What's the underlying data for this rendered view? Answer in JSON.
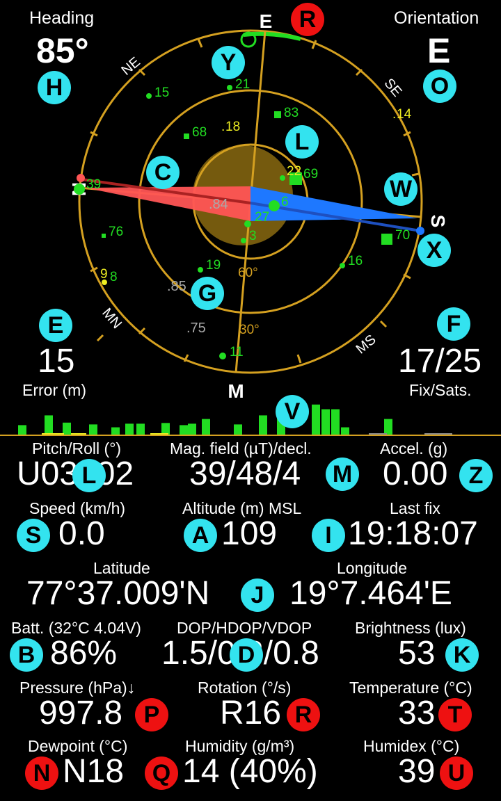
{
  "header": {
    "heading_label": "Heading",
    "heading_value": "85°",
    "orientation_label": "Orientation",
    "orientation_value": "E"
  },
  "compass": {
    "directions": {
      "n": "N",
      "ne": "NE",
      "e": "E",
      "se": "SE",
      "s": "S",
      "sw": "MS",
      "w": "M",
      "nw": "MN"
    },
    "elevations": [
      "30°",
      "60°"
    ],
    "satellites": [
      {
        "id": "15",
        "color": "#22dd22",
        "shape": "dot"
      },
      {
        "id": "21",
        "color": "#22dd22",
        "shape": "dot"
      },
      {
        "id": "83",
        "color": "#22dd22",
        "shape": "square"
      },
      {
        "id": "14",
        "color": "#eeee22",
        "shape": "none"
      },
      {
        "id": "68",
        "color": "#22dd22",
        "shape": "square"
      },
      {
        "id": "18",
        "color": "#eeee22",
        "shape": "none"
      },
      {
        "id": "69",
        "color": "#22dd22",
        "shape": "square"
      },
      {
        "id": "22",
        "color": "#eeee22",
        "shape": "none"
      },
      {
        "id": "39",
        "color": "#22dd22",
        "shape": "dot"
      },
      {
        "id": "6",
        "color": "#22dd22",
        "shape": "dot"
      },
      {
        "id": "27",
        "color": "#22dd22",
        "shape": "dot"
      },
      {
        "id": "3",
        "color": "#22dd22",
        "shape": "dot"
      },
      {
        "id": "76",
        "color": "#22dd22",
        "shape": "square"
      },
      {
        "id": "70",
        "color": "#22dd22",
        "shape": "square"
      },
      {
        "id": "16",
        "color": "#22dd22",
        "shape": "dot"
      },
      {
        "id": "19",
        "color": "#22dd22",
        "shape": "dot"
      },
      {
        "id": "9",
        "color": "#eeee22",
        "shape": "none"
      },
      {
        "id": "8",
        "color": "#22dd22",
        "shape": "dot"
      },
      {
        "id": "11",
        "color": "#22dd22",
        "shape": "dot"
      }
    ],
    "grey_labels": [
      ".84",
      ".85",
      ".75"
    ]
  },
  "stats": {
    "error_label": "Error (m)",
    "error_value": "15",
    "fix_label": "Fix/Sats.",
    "fix_value": "17/25"
  },
  "signal_bars": [
    {
      "level": 0.28,
      "color": "#22dd22"
    },
    {
      "level": 0.0,
      "color": "#22dd22"
    },
    {
      "level": 0.55,
      "color": "#22dd22"
    },
    {
      "level": 0.35,
      "color": "#22dd22"
    },
    {
      "level": 0.3,
      "color": "#22dd22"
    },
    {
      "level": 0.22,
      "color": "#22dd22"
    },
    {
      "level": 0.32,
      "color": "#22dd22"
    },
    {
      "level": 0.32,
      "color": "#22dd22"
    },
    {
      "level": 0.34,
      "color": "#22dd22"
    },
    {
      "level": 0.28,
      "color": "#22dd22"
    },
    {
      "level": 0.32,
      "color": "#22dd22"
    },
    {
      "level": 0.45,
      "color": "#22dd22"
    },
    {
      "level": 0.3,
      "color": "#22dd22"
    },
    {
      "level": 0.55,
      "color": "#22dd22"
    },
    {
      "level": 0.72,
      "color": "#22dd22"
    },
    {
      "level": 0.85,
      "color": "#22dd22"
    },
    {
      "level": 0.72,
      "color": "#22dd22"
    },
    {
      "level": 0.72,
      "color": "#22dd22"
    },
    {
      "level": 0.22,
      "color": "#22dd22"
    },
    {
      "level": 0.45,
      "color": "#22dd22"
    }
  ],
  "fields": {
    "pitch_roll": {
      "label": "Pitch/Roll (°)",
      "value": "U03L02"
    },
    "mag_field": {
      "label": "Mag. field (µT)/decl.",
      "value": "39/48/4"
    },
    "accel": {
      "label": "Accel. (g)",
      "value": "0.00"
    },
    "speed": {
      "label": "Speed (km/h)",
      "value": "0.0"
    },
    "altitude": {
      "label": "Altitude (m) MSL",
      "value": "109"
    },
    "last_fix": {
      "label": "Last fix",
      "value": "19:18:07"
    },
    "latitude": {
      "label": "Latitude",
      "value": "77°37.009'N"
    },
    "longitude": {
      "label": "Longitude",
      "value": "19°7.464'E"
    },
    "battery": {
      "label": "Batt. (32°C 4.04V)",
      "value": "86%"
    },
    "dop": {
      "label": "DOP/HDOP/VDOP",
      "value": "1.5/0.3/0.8"
    },
    "brightness": {
      "label": "Brightness (lux)",
      "value": "53"
    },
    "pressure": {
      "label": "Pressure (hPa)↓",
      "value": "997.8"
    },
    "rotation": {
      "label": "Rotation (°/s)",
      "value": "R16"
    },
    "temperature": {
      "label": "Temperature (°C)",
      "value": "33"
    },
    "dewpoint": {
      "label": "Dewpoint (°C)",
      "value": "N18"
    },
    "humidity": {
      "label": "Humidity (g/m³)",
      "value": "14 (40%)"
    },
    "humidex": {
      "label": "Humidex (°C)",
      "value": "39"
    }
  },
  "badges": {
    "R_top": "R",
    "Y": "Y",
    "H": "H",
    "O": "O",
    "C": "C",
    "L_top": "L",
    "W": "W",
    "X": "X",
    "G": "G",
    "E": "E",
    "F": "F",
    "V": "V",
    "L": "L",
    "M": "M",
    "Z": "Z",
    "S": "S",
    "A": "A",
    "I": "I",
    "J": "J",
    "B": "B",
    "D": "D",
    "K": "K",
    "P": "P",
    "R": "R",
    "T": "T",
    "N": "N",
    "Q": "Q",
    "U": "U"
  },
  "colors": {
    "ring": "#d4a020",
    "badge_cyan": "#33e3ef",
    "badge_red": "#ee1111",
    "arrow_red": "#ff5555",
    "arrow_blue": "#1e78ff"
  }
}
